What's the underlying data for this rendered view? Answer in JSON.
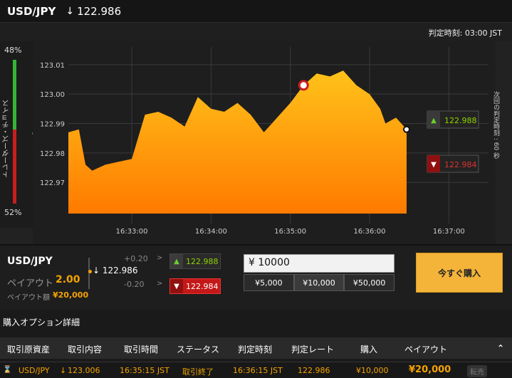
{
  "header": {
    "pair": "USD/JPY",
    "arrow": "↓",
    "rate": "122.986"
  },
  "subbar": {
    "judge_label": "判定時刻:",
    "judge_time": "03:00 JST"
  },
  "sentiment": {
    "top_pct": "48%",
    "bottom_pct": "52%",
    "label": "トレーダーズ・チョイス",
    "green_color": "#35b535",
    "red_color": "#c81e1e"
  },
  "chart": {
    "next_judge_label": "次回の判定時刻 : 60 秒",
    "up_rate": "122.988",
    "down_rate": "122.984"
  },
  "chart_data": {
    "type": "area",
    "title": "",
    "xlabel": "",
    "ylabel": "",
    "x_ticks": [
      "16:33:00",
      "16:34:00",
      "16:35:00",
      "16:36:00",
      "16:37:00"
    ],
    "y_ticks": [
      "123.01",
      "123.00",
      "122.99",
      "122.98",
      "122.97"
    ],
    "ylim": [
      122.957,
      123.016
    ],
    "xlim": [
      "16:32:12",
      "16:37:30"
    ],
    "x": [
      "16:32:12",
      "16:32:20",
      "16:32:25",
      "16:32:30",
      "16:32:40",
      "16:32:50",
      "16:33:00",
      "16:33:10",
      "16:33:20",
      "16:33:30",
      "16:33:40",
      "16:33:50",
      "16:34:00",
      "16:34:10",
      "16:34:20",
      "16:34:30",
      "16:34:40",
      "16:34:50",
      "16:35:00",
      "16:35:10",
      "16:35:20",
      "16:35:30",
      "16:35:40",
      "16:35:50",
      "16:36:00",
      "16:36:08",
      "16:36:12",
      "16:36:20",
      "16:36:28"
    ],
    "values": [
      122.987,
      122.988,
      122.976,
      122.974,
      122.976,
      122.977,
      122.978,
      122.993,
      122.994,
      122.992,
      122.989,
      122.999,
      122.995,
      122.994,
      122.997,
      122.993,
      122.987,
      122.992,
      122.997,
      123.003,
      123.007,
      123.006,
      123.008,
      123.003,
      123.0,
      122.995,
      122.99,
      122.992,
      122.988
    ],
    "fill_top": "#ffc21a",
    "fill_bottom": "#ff7a00",
    "markers": [
      {
        "label": "entry",
        "x": "16:35:10",
        "y": 123.003
      },
      {
        "label": "current",
        "x": "16:36:28",
        "y": 122.988
      }
    ],
    "grid": true
  },
  "trade": {
    "pair": "USD/JPY",
    "payout_label": "ペイアウト",
    "payout_value": "2.00",
    "payout_amount_label": "ペイアウト額",
    "payout_amount_value": "¥20,000",
    "spread_up": "+0.20",
    "spread_down": "-0.20",
    "current_arrow": "↓",
    "current_rate": "122.986",
    "gt": ">",
    "up_rate": "122.988",
    "down_rate": "122.984",
    "amount_value": "¥ 10000",
    "presets": [
      "¥5,000",
      "¥10,000",
      "¥50,000"
    ],
    "buy_label": "今すぐ購入"
  },
  "details": {
    "title": "購入オプション詳細",
    "columns": [
      "取引原資産",
      "取引内容",
      "取引時間",
      "ステータス",
      "判定時刻",
      "判定レート",
      "購入",
      "ペイアウト"
    ],
    "collapse_icon": "⌃",
    "row": {
      "hourglass": "⌛",
      "asset": "USD/JPY",
      "direction": "↓",
      "rate": "123.006",
      "trade_time": "16:35:15 JST",
      "status": "取引終了",
      "judge_time": "16:36:15 JST",
      "judge_rate": "122.986",
      "purchase": "¥10,000",
      "payout": "¥20,000",
      "sell_label": "転売"
    }
  }
}
